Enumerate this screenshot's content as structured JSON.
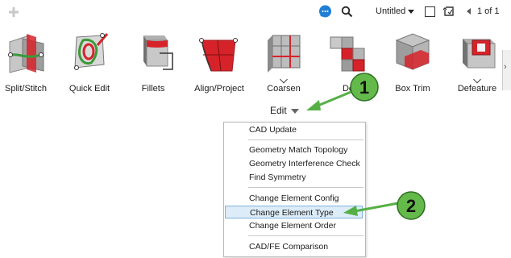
{
  "topbar": {
    "document_name": "Untitled",
    "page_indicator": "1 of 1"
  },
  "ribbon": {
    "tools": [
      {
        "label": "Split/Stitch",
        "icon": "split-stitch-icon"
      },
      {
        "label": "Quick Edit",
        "icon": "quick-edit-icon"
      },
      {
        "label": "Fillets",
        "icon": "fillets-icon"
      },
      {
        "label": "Align/Project",
        "icon": "align-project-icon"
      },
      {
        "label": "Coarsen",
        "icon": "coarsen-icon"
      },
      {
        "label": "De",
        "icon": "de-icon"
      },
      {
        "label": "Box Trim",
        "icon": "box-trim-icon"
      },
      {
        "label": "Defeature",
        "icon": "defeature-icon"
      }
    ]
  },
  "edit_menu": {
    "label": "Edit",
    "items": [
      {
        "label": "CAD Update"
      },
      {
        "label": "Geometry Match Topology"
      },
      {
        "label": "Geometry Interference Check"
      },
      {
        "label": "Find Symmetry"
      },
      {
        "label": "Change Element Config"
      },
      {
        "label": "Change Element Type",
        "highlighted": true
      },
      {
        "label": "Change Element Order"
      },
      {
        "label": "CAD/FE Comparison"
      }
    ]
  },
  "annotations": {
    "badge_1": "1",
    "badge_2": "2",
    "arrow_color": "#54b044",
    "badge_color": "#63b94a"
  },
  "colors": {
    "accent_red": "#d6232a",
    "chat_blue": "#1f7ed6",
    "highlight_bg": "#dcecf8"
  }
}
